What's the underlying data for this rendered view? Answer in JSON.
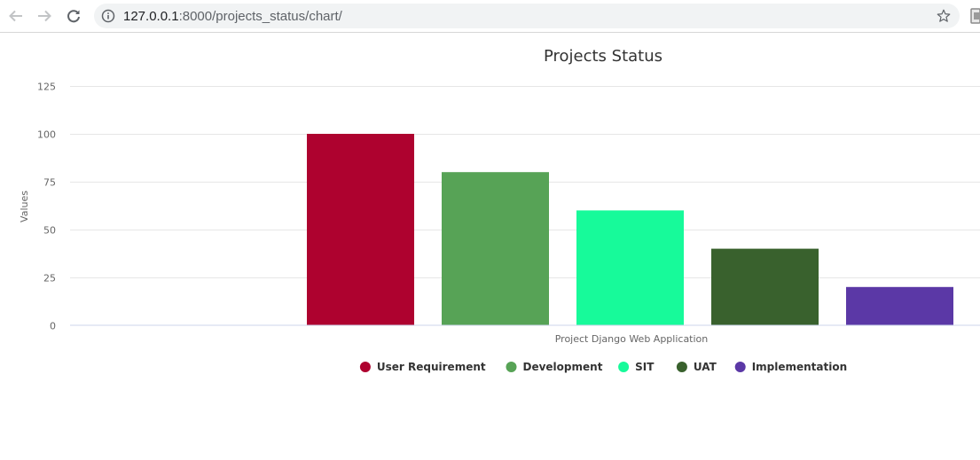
{
  "browser": {
    "url_host": "127.0.0.1",
    "url_rest": ":8000/projects_status/chart/"
  },
  "icons": {
    "back": "arrow-left",
    "forward": "arrow-right",
    "reload": "reload",
    "info": "info-circle",
    "bookmark": "star-outline",
    "extension": "extension"
  },
  "chart_data": {
    "type": "bar",
    "title": "Projects Status",
    "xlabel": "",
    "ylabel": "Values",
    "category": "Project Django Web Application",
    "ylim": [
      0,
      125
    ],
    "yticks": [
      0,
      25,
      50,
      75,
      100,
      125
    ],
    "grid": true,
    "legend_position": "bottom-center",
    "series": [
      {
        "name": "User Requirement",
        "values": [
          100
        ],
        "color": "#ae022f"
      },
      {
        "name": "Development",
        "values": [
          80
        ],
        "color": "#57a356"
      },
      {
        "name": "SIT",
        "values": [
          60
        ],
        "color": "#17fa9a"
      },
      {
        "name": "UAT",
        "values": [
          40
        ],
        "color": "#39612d"
      },
      {
        "name": "Implementation",
        "values": [
          20
        ],
        "color": "#5b38a6"
      }
    ]
  }
}
